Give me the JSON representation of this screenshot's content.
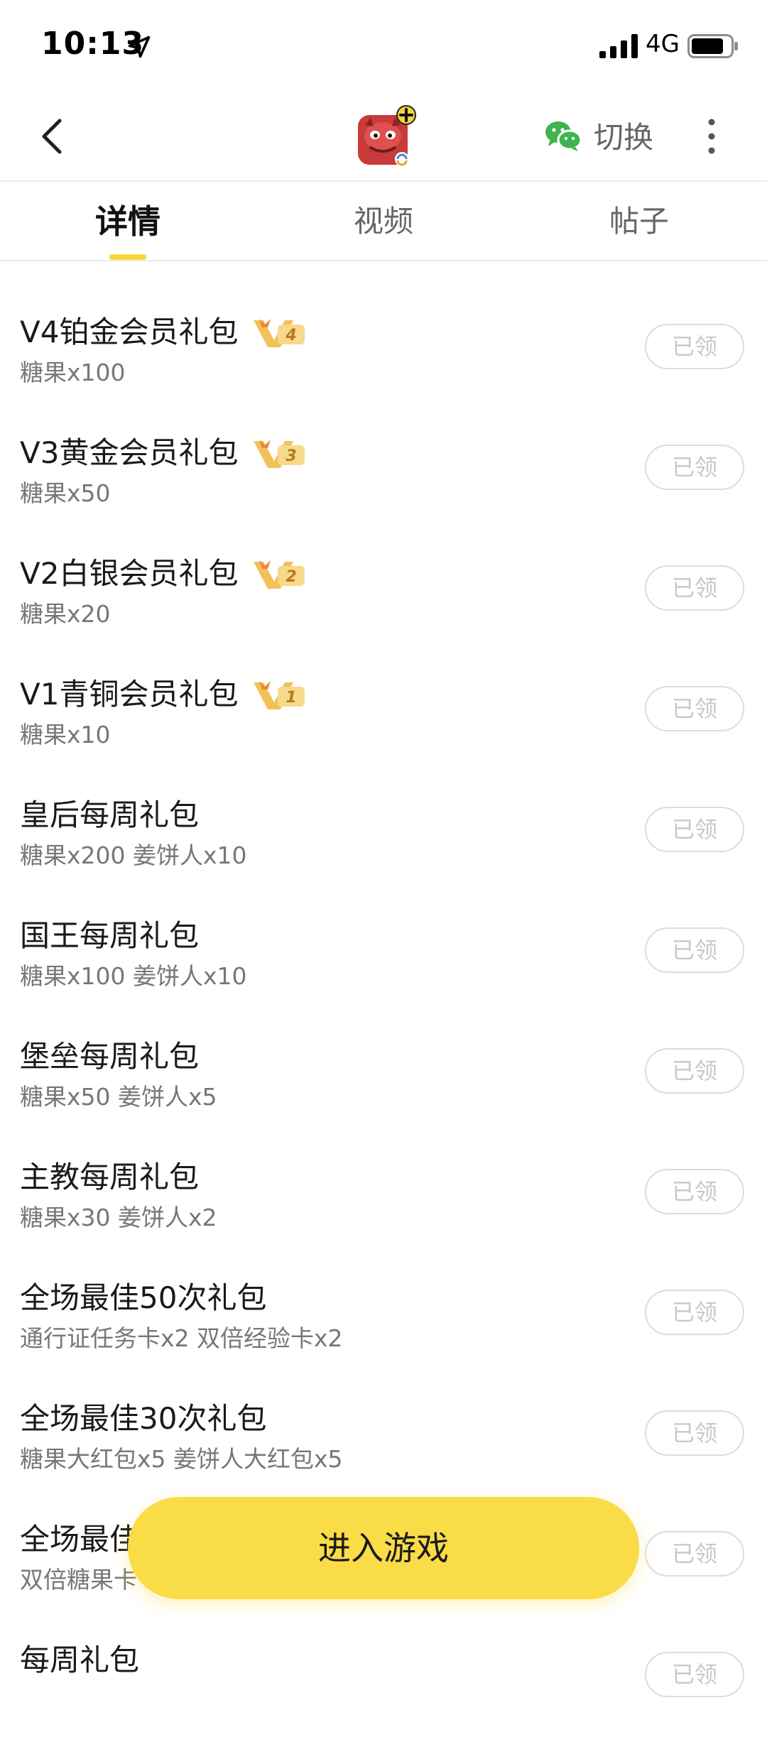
{
  "status_bar": {
    "time": "10:13",
    "network": "4G"
  },
  "nav": {
    "switch_label": "切换"
  },
  "tabs": [
    {
      "label": "详情",
      "active": true
    },
    {
      "label": "视频",
      "active": false
    },
    {
      "label": "帖子",
      "active": false
    }
  ],
  "gifts": [
    {
      "title": "V4铂金会员礼包",
      "badge": "4",
      "desc": "糖果x100",
      "button": "已领"
    },
    {
      "title": "V3黄金会员礼包",
      "badge": "3",
      "desc": "糖果x50",
      "button": "已领"
    },
    {
      "title": "V2白银会员礼包",
      "badge": "2",
      "desc": "糖果x20",
      "button": "已领"
    },
    {
      "title": "V1青铜会员礼包",
      "badge": "1",
      "desc": "糖果x10",
      "button": "已领"
    },
    {
      "title": "皇后每周礼包",
      "desc": "糖果x200 姜饼人x10",
      "button": "已领"
    },
    {
      "title": "国王每周礼包",
      "desc": "糖果x100 姜饼人x10",
      "button": "已领"
    },
    {
      "title": "堡垒每周礼包",
      "desc": "糖果x50 姜饼人x5",
      "button": "已领"
    },
    {
      "title": "主教每周礼包",
      "desc": "糖果x30 姜饼人x2",
      "button": "已领"
    },
    {
      "title": "全场最佳50次礼包",
      "desc": "通行证任务卡x2 双倍经验卡x2",
      "button": "已领"
    },
    {
      "title": "全场最佳30次礼包",
      "desc": "糖果大红包x5 姜饼人大红包x5",
      "button": "已领"
    },
    {
      "title": "全场最佳",
      "desc": "双倍糖果卡",
      "button": "已领"
    },
    {
      "title": "每周礼包",
      "desc": "",
      "button": "已领"
    }
  ],
  "enter_game_label": "进入游戏",
  "colors": {
    "accent": "#f9dc46",
    "badge_gold": "#f2c15a",
    "wechat_green": "#3fb34f"
  }
}
